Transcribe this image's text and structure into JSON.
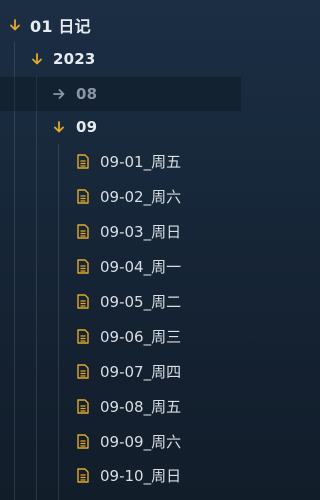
{
  "tree": {
    "root": {
      "label": "01 日记",
      "expanded": true
    },
    "year": {
      "label": "2023",
      "expanded": true
    },
    "month_collapsed": {
      "label": "08",
      "expanded": false
    },
    "month_open": {
      "label": "09",
      "expanded": true
    },
    "files": [
      {
        "label": "09-01_周五"
      },
      {
        "label": "09-02_周六"
      },
      {
        "label": "09-03_周日"
      },
      {
        "label": "09-04_周一"
      },
      {
        "label": "09-05_周二"
      },
      {
        "label": "09-06_周三"
      },
      {
        "label": "09-07_周四"
      },
      {
        "label": "09-08_周五"
      },
      {
        "label": "09-09_周六"
      },
      {
        "label": "09-10_周日"
      }
    ]
  },
  "colors": {
    "accent": "#e0a92c",
    "muted_arrow": "#8a96a3",
    "text": "#e6ebf0"
  },
  "icons": {
    "expanded": "chevron-down-icon",
    "collapsed": "chevron-right-icon",
    "file": "file-icon"
  }
}
